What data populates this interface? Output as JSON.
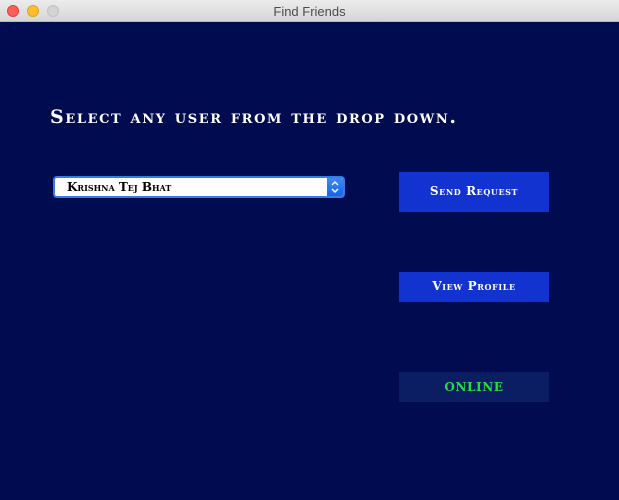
{
  "window": {
    "title": "Find Friends"
  },
  "main": {
    "heading": "Select any user from the drop down.",
    "user_select": {
      "selected_value": "Krishna Tej Bhat"
    },
    "send_request_label": "Send Request",
    "view_profile_label": "View Profile",
    "status_text": "ONLINE"
  },
  "colors": {
    "background": "#000c4f",
    "button": "#1233d0",
    "status_bg": "#0b1d63",
    "status_text": "#22e03a"
  },
  "icons": {
    "combo_arrows": "up-down-chevron-icon"
  }
}
